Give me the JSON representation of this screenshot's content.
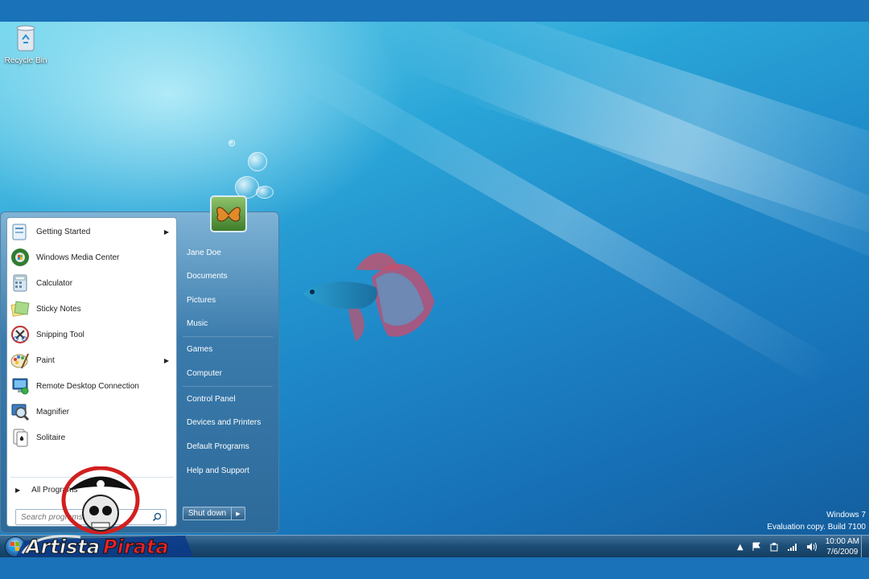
{
  "desktop": {
    "icons": [
      {
        "label": "Recycle Bin",
        "icon": "recycle-bin-icon"
      }
    ],
    "watermark": {
      "line1": "Windows 7",
      "line2": "Evaluation copy. Build 7100"
    }
  },
  "start_menu": {
    "programs": [
      {
        "label": "Getting Started",
        "icon": "getting-started-icon",
        "submenu": true
      },
      {
        "label": "Windows Media Center",
        "icon": "media-center-icon",
        "submenu": false
      },
      {
        "label": "Calculator",
        "icon": "calculator-icon",
        "submenu": false
      },
      {
        "label": "Sticky Notes",
        "icon": "sticky-notes-icon",
        "submenu": false
      },
      {
        "label": "Snipping Tool",
        "icon": "snipping-tool-icon",
        "submenu": false
      },
      {
        "label": "Paint",
        "icon": "paint-icon",
        "submenu": true
      },
      {
        "label": "Remote Desktop Connection",
        "icon": "remote-desktop-icon",
        "submenu": false
      },
      {
        "label": "Magnifier",
        "icon": "magnifier-icon",
        "submenu": false
      },
      {
        "label": "Solitaire",
        "icon": "solitaire-icon",
        "submenu": false
      }
    ],
    "all_programs": "All Programs",
    "search_placeholder": "Search programs and files",
    "right_links": [
      "Jane Doe",
      "Documents",
      "Pictures",
      "Music",
      "Games",
      "Computer",
      "Control Panel",
      "Devices and Printers",
      "Default Programs",
      "Help and Support"
    ],
    "shutdown_label": "Shut down"
  },
  "taskbar": {
    "clock_time": "10:00 AM",
    "clock_date": "7/6/2009"
  },
  "logo_text": "ArtistaPirata",
  "colors": {
    "accent": "#1a72b8",
    "taskbar": "#1d4f78",
    "menu_right": "#2d6a9a"
  }
}
